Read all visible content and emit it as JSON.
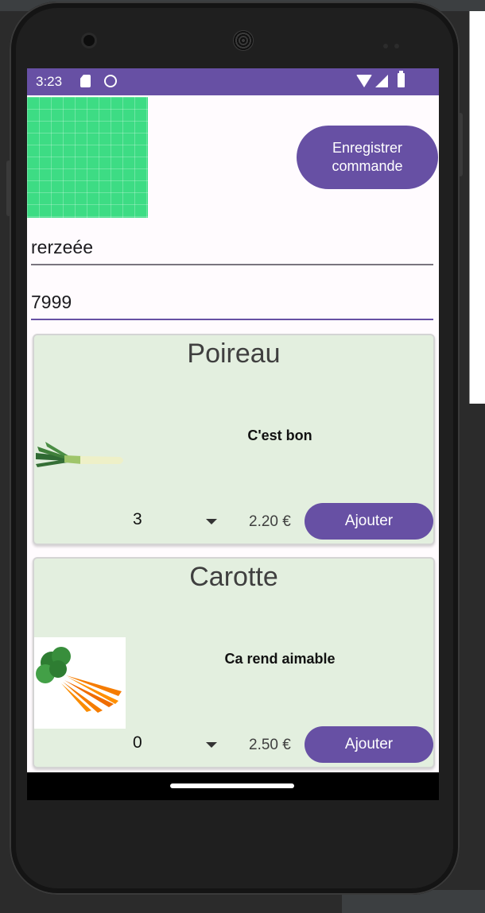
{
  "status_bar": {
    "time": "3:23"
  },
  "header": {
    "save_button_label": "Enregistrer\ncommande"
  },
  "form": {
    "name_value": "rerzeée",
    "number_value": "7999"
  },
  "products": [
    {
      "name": "Poireau",
      "description": "C'est bon",
      "quantity": "3",
      "price": "2.20 €",
      "add_label": "Ajouter",
      "image": "leek-image"
    },
    {
      "name": "Carotte",
      "description": "Ca rend aimable",
      "quantity": "0",
      "price": "2.50 €",
      "add_label": "Ajouter",
      "image": "carrot-image"
    }
  ],
  "colors": {
    "primary": "#6750a4",
    "card_background": "#e3efdf",
    "placeholder_image": "#3ddc84"
  }
}
